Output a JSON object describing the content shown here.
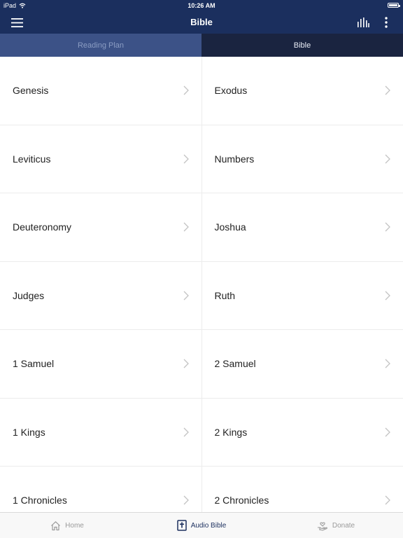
{
  "status_bar": {
    "device": "iPad",
    "time": "10:26 AM"
  },
  "header": {
    "title": "Bible"
  },
  "tabs": [
    {
      "label": "Reading Plan",
      "active": false
    },
    {
      "label": "Bible",
      "active": true
    }
  ],
  "books": [
    [
      "Genesis",
      "Exodus"
    ],
    [
      "Leviticus",
      "Numbers"
    ],
    [
      "Deuteronomy",
      "Joshua"
    ],
    [
      "Judges",
      "Ruth"
    ],
    [
      "1 Samuel",
      "2 Samuel"
    ],
    [
      "1 Kings",
      "2 Kings"
    ],
    [
      "1 Chronicles",
      "2 Chronicles"
    ]
  ],
  "bottom_tabs": [
    {
      "label": "Home",
      "icon": "home-icon",
      "selected": false
    },
    {
      "label": "Audio Bible",
      "icon": "bible-icon",
      "selected": true
    },
    {
      "label": "Donate",
      "icon": "donate-hand-icon",
      "selected": false
    }
  ],
  "colors": {
    "nav": "#1b2f5e",
    "tab_inactive": "#3c5287",
    "tab_active": "#1a2440",
    "accent": "#1b2f5e"
  }
}
